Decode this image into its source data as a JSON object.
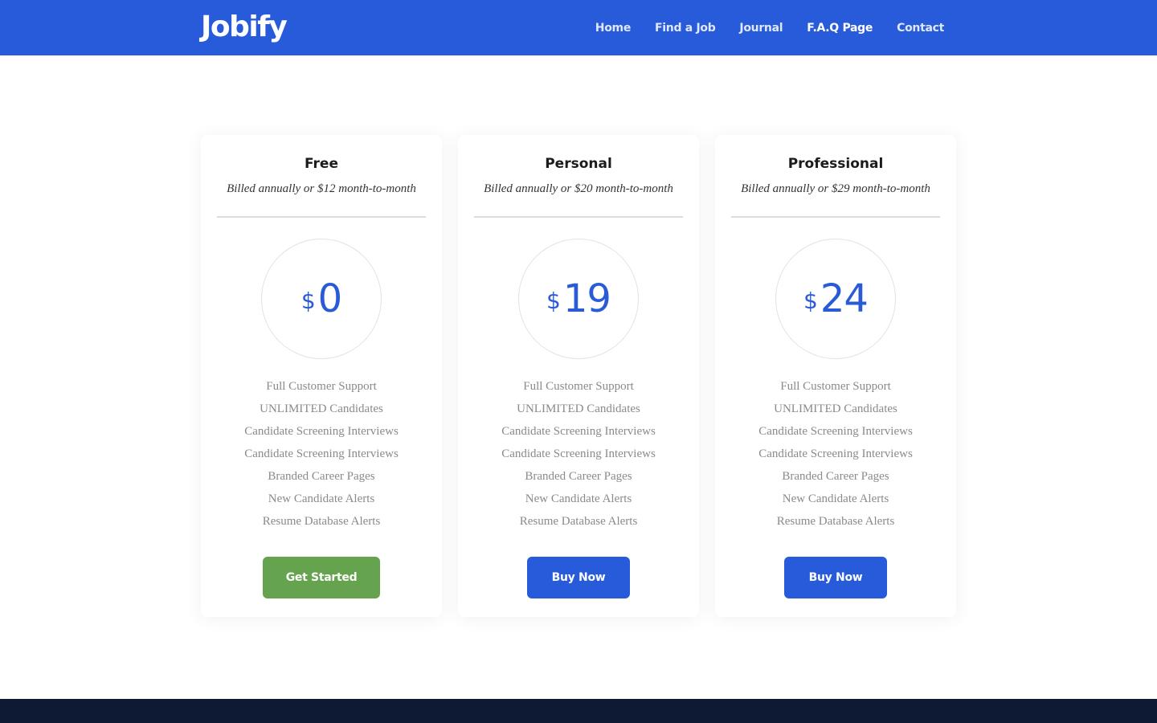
{
  "header": {
    "logo": "Jobify",
    "nav": [
      "Home",
      "Find a Job",
      "Journal",
      "F.A.Q Page",
      "Contact"
    ],
    "active_nav": "F.A.Q Page",
    "bg_color": "#285bd9"
  },
  "plans": [
    {
      "name": "Free",
      "billing": "Billed annually or $12 month-to-month",
      "currency": "$",
      "price": "0",
      "features": [
        "Full Customer Support",
        "UNLIMITED Candidates",
        "Candidate Screening Interviews",
        "Candidate Screening Interviews",
        "Branded Career Pages",
        "New Candidate Alerts",
        "Resume Database Alerts"
      ],
      "button_label": "Get Started",
      "button_color": "#66a34f"
    },
    {
      "name": "Personal",
      "billing": "Billed annually or $20 month-to-month",
      "currency": "$",
      "price": "19",
      "features": [
        "Full Customer Support",
        "UNLIMITED Candidates",
        "Candidate Screening Interviews",
        "Candidate Screening Interviews",
        "Branded Career Pages",
        "New Candidate Alerts",
        "Resume Database Alerts"
      ],
      "button_label": "Buy Now",
      "button_color": "#285bd9"
    },
    {
      "name": "Professional",
      "billing": "Billed annually or $29 month-to-month",
      "currency": "$",
      "price": "24",
      "features": [
        "Full Customer Support",
        "UNLIMITED Candidates",
        "Candidate Screening Interviews",
        "Candidate Screening Interviews",
        "Branded Career Pages",
        "New Candidate Alerts",
        "Resume Database Alerts"
      ],
      "button_label": "Buy Now",
      "button_color": "#285bd9"
    }
  ],
  "colors": {
    "accent": "#2a5bd7",
    "footer": "#0e1a33"
  }
}
